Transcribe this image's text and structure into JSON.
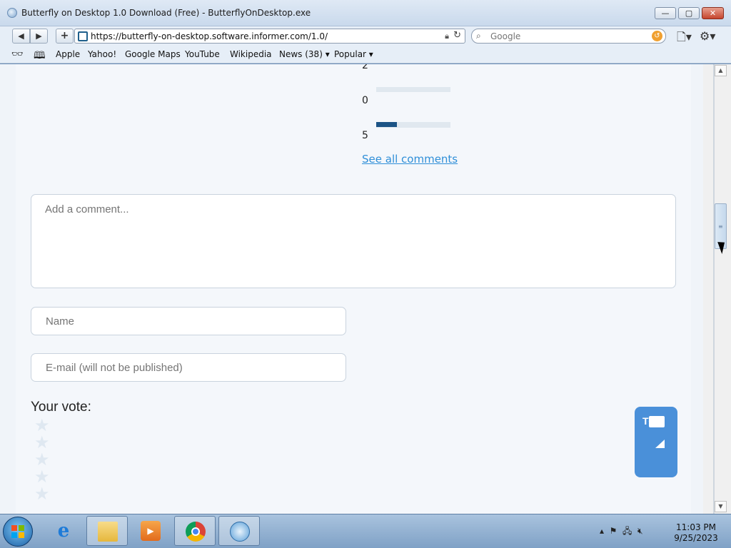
{
  "window": {
    "title": "Butterfly on Desktop 1.0 Download (Free) - ButterflyOnDesktop.exe",
    "minimize": "—",
    "maximize": "▢",
    "close": "✕"
  },
  "nav": {
    "back": "◀",
    "forward": "▶",
    "add": "+",
    "url": "https://butterfly-on-desktop.software.informer.com/1.0/",
    "search_placeholder": "Google"
  },
  "bookmarks": {
    "items": [
      "Apple",
      "Yahoo!",
      "Google Maps",
      "YouTube",
      "Wikipedia",
      "News (38) ▾",
      "Popular ▾"
    ]
  },
  "ratings": {
    "rows": [
      {
        "label": "2",
        "fraction": 0
      },
      {
        "label": "0",
        "fraction": 0
      },
      {
        "label": "5",
        "fraction": 0.28
      }
    ],
    "see_all": "See all comments"
  },
  "comment_form": {
    "comment_placeholder": "Add a comment...",
    "name_placeholder": "Name",
    "email_placeholder": "E-mail (will not be published)",
    "vote_label": "Your vote:",
    "stars": 5
  },
  "top_button": {
    "label": "TOP"
  },
  "taskbar": {
    "items": [
      "internet-explorer",
      "file-explorer",
      "media-player",
      "chrome",
      "safari"
    ],
    "clock_time": "11:03 PM",
    "clock_date": "9/25/2023"
  },
  "colors": {
    "accent": "#4a90d9",
    "link": "#2f8fd8",
    "bar_fill": "#1c5486"
  }
}
